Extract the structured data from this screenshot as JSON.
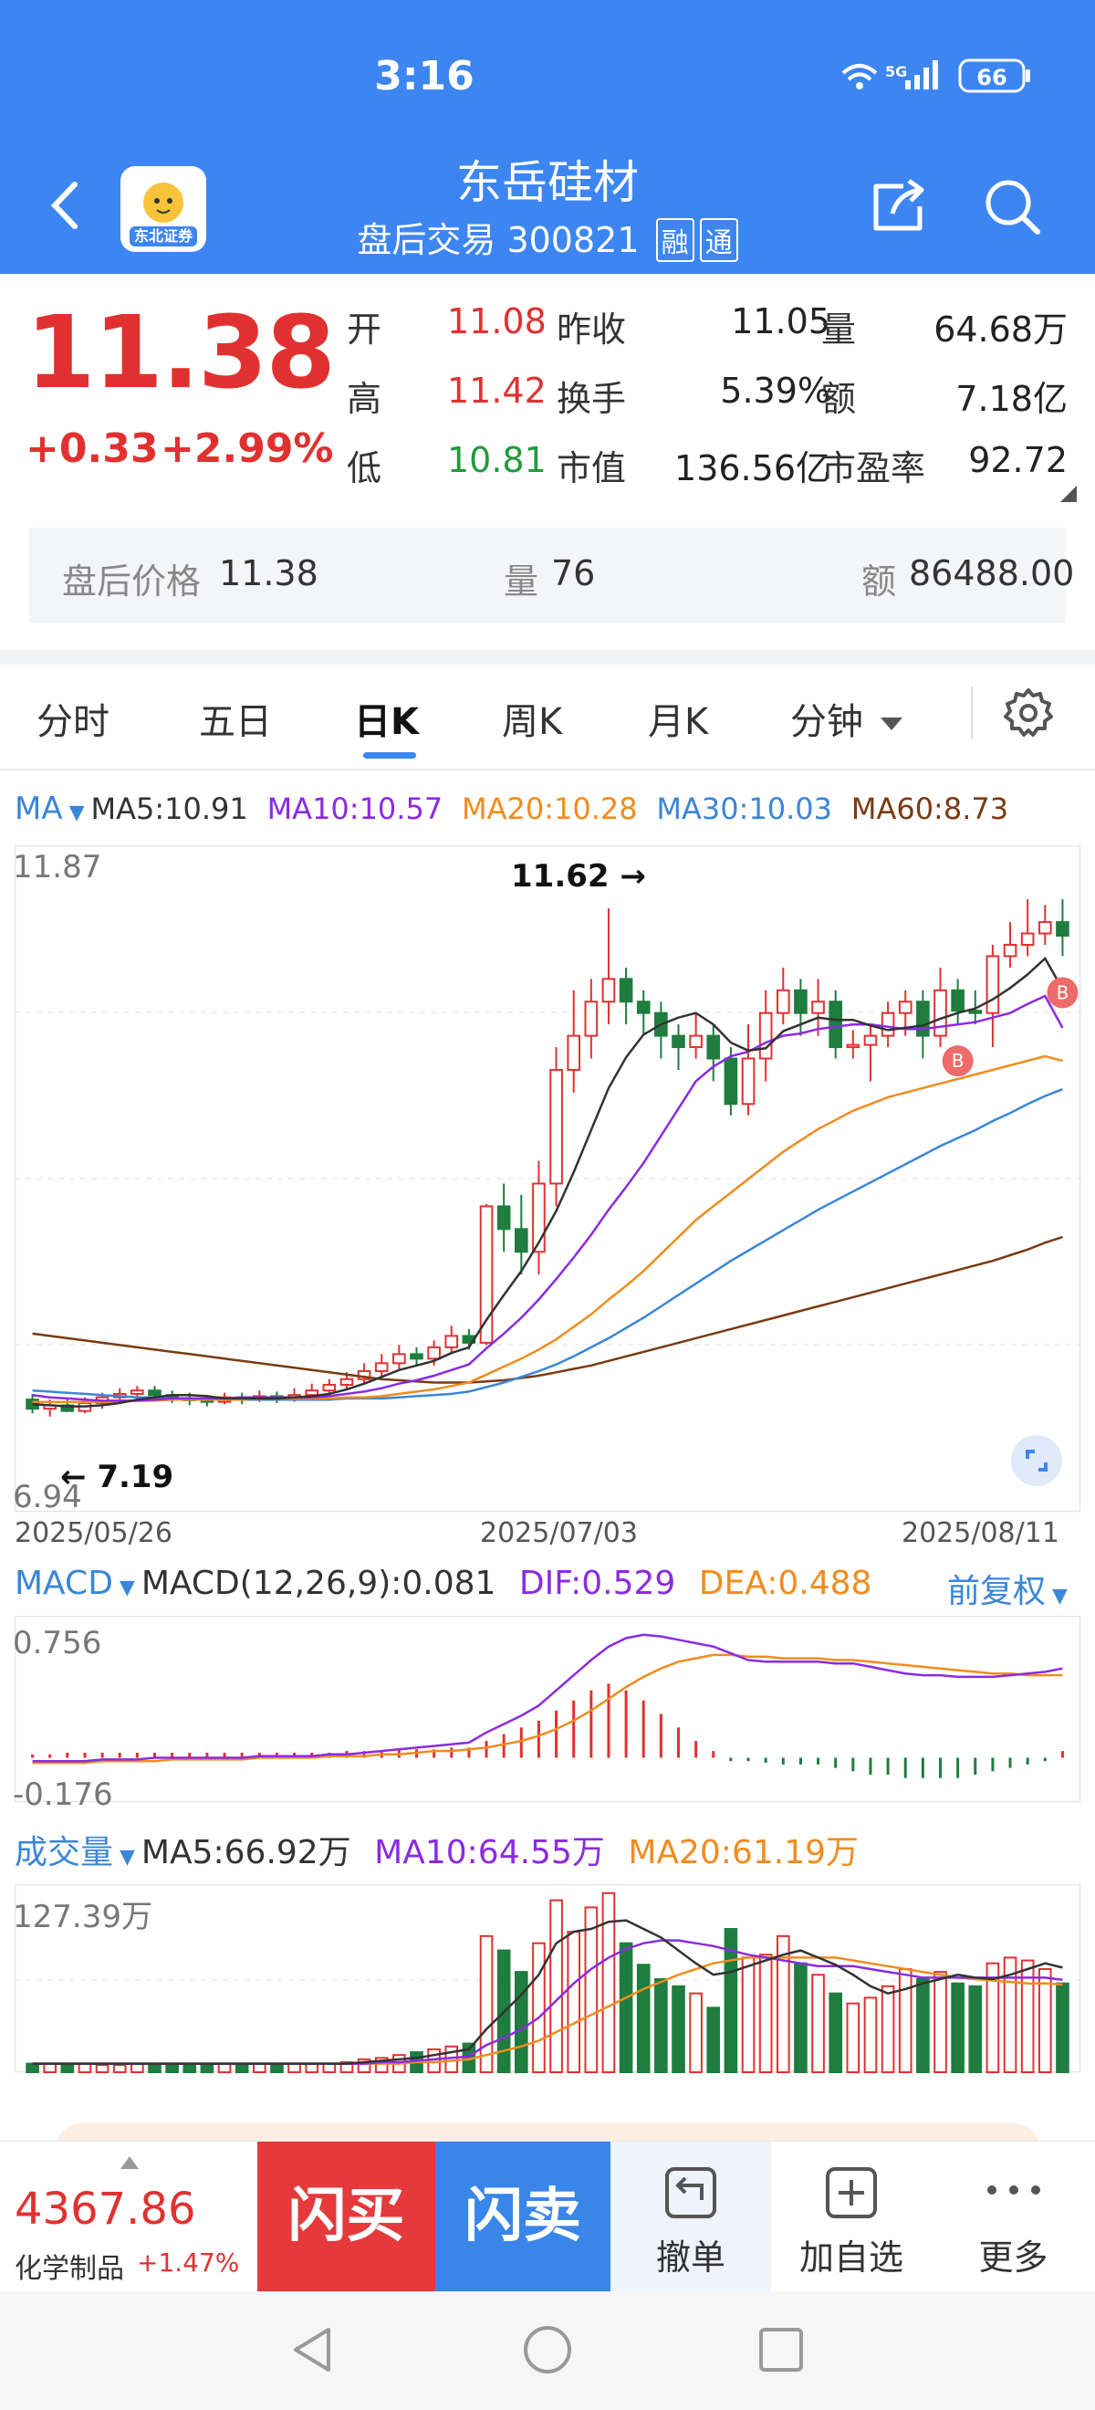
{
  "status": {
    "time": "3:16",
    "network": "5G",
    "battery": "66"
  },
  "header": {
    "title": "东岳硅材",
    "subtitle": "盘后交易 300821",
    "tags": [
      "融",
      "通"
    ],
    "logo_text": "东北证券"
  },
  "quote": {
    "price": "11.38",
    "change": "+0.33",
    "change_pct": "+2.99%",
    "rows": [
      {
        "l1": "开",
        "v1": "11.08",
        "l2": "昨收",
        "v2": "11.05",
        "l3": "量",
        "v3": "64.68万"
      },
      {
        "l1": "高",
        "v1": "11.42",
        "l2": "换手",
        "v2": "5.39%",
        "l3": "额",
        "v3": "7.18亿"
      },
      {
        "l1": "低",
        "v1": "10.81",
        "l2": "市值",
        "v2": "136.56亿",
        "l3": "市盈率",
        "v3": "92.72"
      }
    ]
  },
  "after_hours": {
    "price_label": "盘后价格",
    "price": "11.38",
    "vol_label": "量",
    "vol": "76",
    "amt_label": "额",
    "amt": "86488.00"
  },
  "tabs": [
    "分时",
    "五日",
    "日K",
    "周K",
    "月K",
    "分钟"
  ],
  "active_tab": "日K",
  "ma_legend": {
    "name": "MA",
    "ma5": "MA5:10.91",
    "ma10": "MA10:10.57",
    "ma20": "MA20:10.28",
    "ma30": "MA30:10.03",
    "ma60": "MA60:8.73"
  },
  "colors": {
    "up": "#e03130",
    "down": "#1f7d3f",
    "ma5": "#333333",
    "ma10": "#8a2be2",
    "ma20": "#f08c1e",
    "ma30": "#3a86d8",
    "ma60": "#7a3a12",
    "blue": "#3d86f1"
  },
  "chart_data": [
    {
      "type": "candlestick",
      "title": "日K",
      "ylim": [
        6.94,
        11.87
      ],
      "y_top_label": "11.87",
      "y_bottom_label": "6.94",
      "x_labels": [
        "2025/05/26",
        "2025/07/03",
        "2025/08/11"
      ],
      "annotations": {
        "high": "11.62 →",
        "low": "← 7.19"
      },
      "candles": [
        [
          7.3,
          7.22,
          7.35,
          7.18
        ],
        [
          7.22,
          7.25,
          7.3,
          7.15
        ],
        [
          7.25,
          7.2,
          7.3,
          7.19
        ],
        [
          7.2,
          7.27,
          7.32,
          7.18
        ],
        [
          7.27,
          7.32,
          7.36,
          7.22
        ],
        [
          7.32,
          7.35,
          7.4,
          7.28
        ],
        [
          7.35,
          7.38,
          7.42,
          7.3
        ],
        [
          7.38,
          7.34,
          7.42,
          7.3
        ],
        [
          7.34,
          7.31,
          7.38,
          7.27
        ],
        [
          7.31,
          7.3,
          7.36,
          7.25
        ],
        [
          7.3,
          7.28,
          7.34,
          7.24
        ],
        [
          7.28,
          7.32,
          7.36,
          7.26
        ],
        [
          7.32,
          7.3,
          7.36,
          7.26
        ],
        [
          7.3,
          7.33,
          7.38,
          7.28
        ],
        [
          7.33,
          7.31,
          7.37,
          7.27
        ],
        [
          7.31,
          7.34,
          7.4,
          7.28
        ],
        [
          7.34,
          7.38,
          7.44,
          7.3
        ],
        [
          7.38,
          7.43,
          7.48,
          7.33
        ],
        [
          7.43,
          7.48,
          7.54,
          7.38
        ],
        [
          7.48,
          7.55,
          7.62,
          7.43
        ],
        [
          7.55,
          7.62,
          7.7,
          7.5
        ],
        [
          7.62,
          7.7,
          7.78,
          7.56
        ],
        [
          7.7,
          7.66,
          7.76,
          7.6
        ],
        [
          7.66,
          7.76,
          7.82,
          7.6
        ],
        [
          7.76,
          7.86,
          7.95,
          7.7
        ],
        [
          7.86,
          7.8,
          7.92,
          7.74
        ],
        [
          7.8,
          9.0,
          9.02,
          7.78
        ],
        [
          9.0,
          8.8,
          9.2,
          8.6
        ],
        [
          8.8,
          8.6,
          9.1,
          8.4
        ],
        [
          8.6,
          9.2,
          9.4,
          8.4
        ],
        [
          9.2,
          10.2,
          10.4,
          9.0
        ],
        [
          10.2,
          10.5,
          10.9,
          10.0
        ],
        [
          10.5,
          10.8,
          11.0,
          10.3
        ],
        [
          10.8,
          11.0,
          11.62,
          10.6
        ],
        [
          11.0,
          10.8,
          11.1,
          10.6
        ],
        [
          10.8,
          10.7,
          10.9,
          10.5
        ],
        [
          10.7,
          10.5,
          10.8,
          10.3
        ],
        [
          10.5,
          10.4,
          10.6,
          10.2
        ],
        [
          10.4,
          10.5,
          10.7,
          10.3
        ],
        [
          10.5,
          10.3,
          10.6,
          10.1
        ],
        [
          10.3,
          9.9,
          10.4,
          9.8
        ],
        [
          9.9,
          10.3,
          10.6,
          9.8
        ],
        [
          10.3,
          10.7,
          10.9,
          10.1
        ],
        [
          10.7,
          10.9,
          11.1,
          10.6
        ],
        [
          10.9,
          10.7,
          11.0,
          10.5
        ],
        [
          10.7,
          10.8,
          11.0,
          10.5
        ],
        [
          10.8,
          10.4,
          10.9,
          10.3
        ],
        [
          10.4,
          10.42,
          10.55,
          10.3
        ],
        [
          10.42,
          10.5,
          10.6,
          10.1
        ],
        [
          10.5,
          10.7,
          10.8,
          10.4
        ],
        [
          10.7,
          10.8,
          10.9,
          10.5
        ],
        [
          10.8,
          10.5,
          10.9,
          10.3
        ],
        [
          10.5,
          10.9,
          11.1,
          10.4
        ],
        [
          10.9,
          10.72,
          11.0,
          10.6
        ],
        [
          10.72,
          10.7,
          10.9,
          10.6
        ],
        [
          10.7,
          11.2,
          11.3,
          10.4
        ],
        [
          11.2,
          11.3,
          11.5,
          11.1
        ],
        [
          11.3,
          11.4,
          11.7,
          11.2
        ],
        [
          11.4,
          11.5,
          11.65,
          11.3
        ],
        [
          11.5,
          11.38,
          11.7,
          11.2
        ]
      ],
      "ma": {
        "ma5": [
          7.26,
          7.25,
          7.24,
          7.24,
          7.25,
          7.27,
          7.3,
          7.32,
          7.34,
          7.34,
          7.33,
          7.31,
          7.31,
          7.31,
          7.31,
          7.32,
          7.33,
          7.35,
          7.39,
          7.44,
          7.5,
          7.56,
          7.6,
          7.64,
          7.71,
          7.76,
          8.0,
          8.22,
          8.43,
          8.68,
          8.96,
          9.3,
          9.67,
          10.04,
          10.31,
          10.51,
          10.6,
          10.66,
          10.7,
          10.6,
          10.44,
          10.37,
          10.39,
          10.54,
          10.6,
          10.66,
          10.64,
          10.64,
          10.59,
          10.55,
          10.57,
          10.59,
          10.65,
          10.7,
          10.74,
          10.82,
          10.92,
          11.04,
          11.18,
          10.91
        ],
        "ma10": [
          7.34,
          7.32,
          7.31,
          7.3,
          7.29,
          7.29,
          7.29,
          7.3,
          7.31,
          7.31,
          7.31,
          7.31,
          7.32,
          7.32,
          7.32,
          7.32,
          7.32,
          7.33,
          7.35,
          7.37,
          7.4,
          7.44,
          7.47,
          7.51,
          7.56,
          7.61,
          7.75,
          7.88,
          8.02,
          8.18,
          8.36,
          8.55,
          8.75,
          8.97,
          9.17,
          9.38,
          9.62,
          9.86,
          10.1,
          10.23,
          10.32,
          10.36,
          10.44,
          10.5,
          10.52,
          10.56,
          10.58,
          10.6,
          10.6,
          10.58,
          10.56,
          10.56,
          10.58,
          10.6,
          10.62,
          10.66,
          10.7,
          10.78,
          10.85,
          10.57
        ],
        "ma20": [
          7.28,
          7.28,
          7.28,
          7.28,
          7.28,
          7.28,
          7.29,
          7.29,
          7.3,
          7.3,
          7.3,
          7.3,
          7.3,
          7.31,
          7.31,
          7.31,
          7.31,
          7.31,
          7.32,
          7.32,
          7.33,
          7.35,
          7.37,
          7.39,
          7.42,
          7.45,
          7.52,
          7.59,
          7.66,
          7.74,
          7.83,
          7.94,
          8.05,
          8.18,
          8.3,
          8.43,
          8.58,
          8.73,
          8.88,
          9.0,
          9.12,
          9.24,
          9.36,
          9.48,
          9.58,
          9.68,
          9.76,
          9.84,
          9.9,
          9.96,
          10.0,
          10.04,
          10.08,
          10.12,
          10.16,
          10.2,
          10.24,
          10.28,
          10.32,
          10.28
        ],
        "ma30": [
          7.38,
          7.37,
          7.36,
          7.35,
          7.34,
          7.33,
          7.32,
          7.32,
          7.31,
          7.31,
          7.3,
          7.3,
          7.3,
          7.3,
          7.3,
          7.3,
          7.3,
          7.3,
          7.31,
          7.31,
          7.31,
          7.32,
          7.33,
          7.34,
          7.35,
          7.37,
          7.41,
          7.45,
          7.5,
          7.55,
          7.61,
          7.68,
          7.76,
          7.84,
          7.93,
          8.02,
          8.12,
          8.22,
          8.32,
          8.42,
          8.52,
          8.61,
          8.7,
          8.79,
          8.88,
          8.97,
          9.05,
          9.13,
          9.21,
          9.29,
          9.37,
          9.45,
          9.53,
          9.6,
          9.67,
          9.75,
          9.82,
          9.9,
          9.97,
          10.03
        ],
        "ma60": [
          7.88,
          7.86,
          7.84,
          7.82,
          7.8,
          7.78,
          7.76,
          7.74,
          7.72,
          7.7,
          7.68,
          7.66,
          7.64,
          7.62,
          7.6,
          7.58,
          7.56,
          7.54,
          7.52,
          7.5,
          7.48,
          7.47,
          7.46,
          7.45,
          7.45,
          7.45,
          7.46,
          7.47,
          7.49,
          7.51,
          7.54,
          7.57,
          7.6,
          7.64,
          7.68,
          7.72,
          7.76,
          7.8,
          7.84,
          7.88,
          7.92,
          7.96,
          8.0,
          8.04,
          8.08,
          8.12,
          8.16,
          8.2,
          8.24,
          8.28,
          8.32,
          8.36,
          8.4,
          8.44,
          8.48,
          8.52,
          8.57,
          8.62,
          8.68,
          8.73
        ]
      },
      "signals": [
        {
          "label": "B",
          "index": 53
        },
        {
          "label": "B",
          "index": 59
        }
      ]
    },
    {
      "type": "bar",
      "title": "MACD",
      "ylim": [
        -0.176,
        0.756
      ],
      "y_top_label": "0.756",
      "y_bottom_label": "-0.176",
      "histogram": [
        0.02,
        0.02,
        0.03,
        0.03,
        0.03,
        0.03,
        0.03,
        0.03,
        0.03,
        0.03,
        0.03,
        0.03,
        0.03,
        0.03,
        0.03,
        0.03,
        0.03,
        0.03,
        0.04,
        0.04,
        0.04,
        0.05,
        0.05,
        0.05,
        0.06,
        0.06,
        0.1,
        0.14,
        0.18,
        0.22,
        0.28,
        0.34,
        0.4,
        0.44,
        0.4,
        0.34,
        0.26,
        0.18,
        0.1,
        0.04,
        -0.02,
        -0.02,
        -0.03,
        -0.04,
        -0.04,
        -0.04,
        -0.06,
        -0.08,
        -0.1,
        -0.1,
        -0.12,
        -0.12,
        -0.12,
        -0.12,
        -0.1,
        -0.08,
        -0.06,
        -0.04,
        -0.02,
        0.04
      ],
      "dif": [
        -0.02,
        -0.02,
        -0.02,
        -0.02,
        -0.01,
        -0.01,
        -0.01,
        0.0,
        0.0,
        0.0,
        0.0,
        0.0,
        0.0,
        0.01,
        0.01,
        0.01,
        0.01,
        0.02,
        0.02,
        0.03,
        0.04,
        0.05,
        0.06,
        0.07,
        0.08,
        0.09,
        0.15,
        0.2,
        0.25,
        0.31,
        0.4,
        0.49,
        0.58,
        0.66,
        0.71,
        0.73,
        0.72,
        0.7,
        0.68,
        0.66,
        0.62,
        0.58,
        0.57,
        0.57,
        0.57,
        0.57,
        0.56,
        0.56,
        0.54,
        0.52,
        0.5,
        0.49,
        0.49,
        0.48,
        0.48,
        0.48,
        0.49,
        0.5,
        0.51,
        0.53
      ],
      "dea": [
        -0.03,
        -0.03,
        -0.03,
        -0.03,
        -0.02,
        -0.02,
        -0.02,
        -0.02,
        -0.01,
        -0.01,
        -0.01,
        -0.01,
        -0.01,
        0.0,
        0.0,
        0.0,
        0.0,
        0.01,
        0.01,
        0.01,
        0.02,
        0.02,
        0.03,
        0.04,
        0.04,
        0.05,
        0.06,
        0.08,
        0.1,
        0.13,
        0.17,
        0.22,
        0.28,
        0.35,
        0.42,
        0.48,
        0.53,
        0.57,
        0.59,
        0.61,
        0.61,
        0.6,
        0.6,
        0.59,
        0.59,
        0.59,
        0.58,
        0.58,
        0.57,
        0.56,
        0.55,
        0.54,
        0.53,
        0.52,
        0.51,
        0.5,
        0.5,
        0.49,
        0.49,
        0.49
      ]
    },
    {
      "type": "bar",
      "title": "成交量",
      "ylim": [
        0,
        127.39
      ],
      "y_top_label": "127.39万",
      "volumes": [
        6,
        6,
        5,
        6,
        5,
        5,
        6,
        6,
        5,
        5,
        5,
        6,
        6,
        6,
        5,
        6,
        6,
        6,
        7,
        9,
        10,
        12,
        14,
        16,
        18,
        20,
        95,
        85,
        70,
        90,
        120,
        98,
        115,
        125,
        90,
        75,
        65,
        60,
        55,
        45,
        100,
        80,
        82,
        95,
        76,
        68,
        55,
        48,
        52,
        60,
        72,
        65,
        70,
        62,
        60,
        76,
        80,
        78,
        72,
        62
      ],
      "ma": {
        "ma5": [
          6,
          6,
          6,
          6,
          6,
          6,
          6,
          6,
          6,
          6,
          6,
          6,
          6,
          6,
          6,
          6,
          6,
          6,
          6,
          7,
          8,
          9,
          10,
          12,
          14,
          16,
          30,
          42,
          54,
          68,
          90,
          98,
          100,
          105,
          106,
          100,
          94,
          85,
          76,
          68,
          70,
          74,
          78,
          82,
          85,
          80,
          75,
          68,
          60,
          55,
          58,
          62,
          65,
          68,
          66,
          65,
          68,
          72,
          76,
          73
        ],
        "ma10": [
          6,
          6,
          6,
          6,
          6,
          6,
          6,
          6,
          6,
          6,
          6,
          6,
          6,
          6,
          6,
          6,
          6,
          6,
          6,
          6,
          7,
          7,
          8,
          9,
          10,
          11,
          19,
          24,
          30,
          38,
          50,
          62,
          72,
          80,
          86,
          90,
          92,
          92,
          90,
          88,
          85,
          82,
          80,
          78,
          76,
          74,
          74,
          74,
          72,
          70,
          68,
          66,
          66,
          66,
          66,
          66,
          66,
          66,
          66,
          64.55
        ],
        "ma20": [
          6,
          6,
          6,
          6,
          6,
          6,
          6,
          6,
          6,
          6,
          6,
          6,
          6,
          6,
          6,
          6,
          6,
          6,
          6,
          6,
          6,
          6,
          7,
          7,
          8,
          9,
          12,
          15,
          18,
          22,
          28,
          34,
          40,
          46,
          52,
          58,
          63,
          68,
          72,
          76,
          78,
          80,
          80,
          80,
          80,
          80,
          80,
          78,
          76,
          74,
          72,
          70,
          68,
          66,
          65,
          64,
          63,
          62,
          62,
          61.19
        ]
      }
    }
  ],
  "macd_legend": {
    "name": "MACD",
    "value": "MACD(12,26,9):0.081",
    "dif": "DIF:0.529",
    "dea": "DEA:0.488",
    "adjust": "前复权"
  },
  "vol_legend": {
    "name": "成交量",
    "ma5": "MA5:66.92万",
    "ma10": "MA10:64.55万",
    "ma20": "MA20:61.19万"
  },
  "bottom": {
    "index_value": "4367.86",
    "index_name": "化学制品",
    "index_change": "+1.47%",
    "buy_label": "闪买",
    "sell_label": "闪卖",
    "cancel_label": "撤单",
    "watch_label": "加自选",
    "more_label": "更多"
  }
}
